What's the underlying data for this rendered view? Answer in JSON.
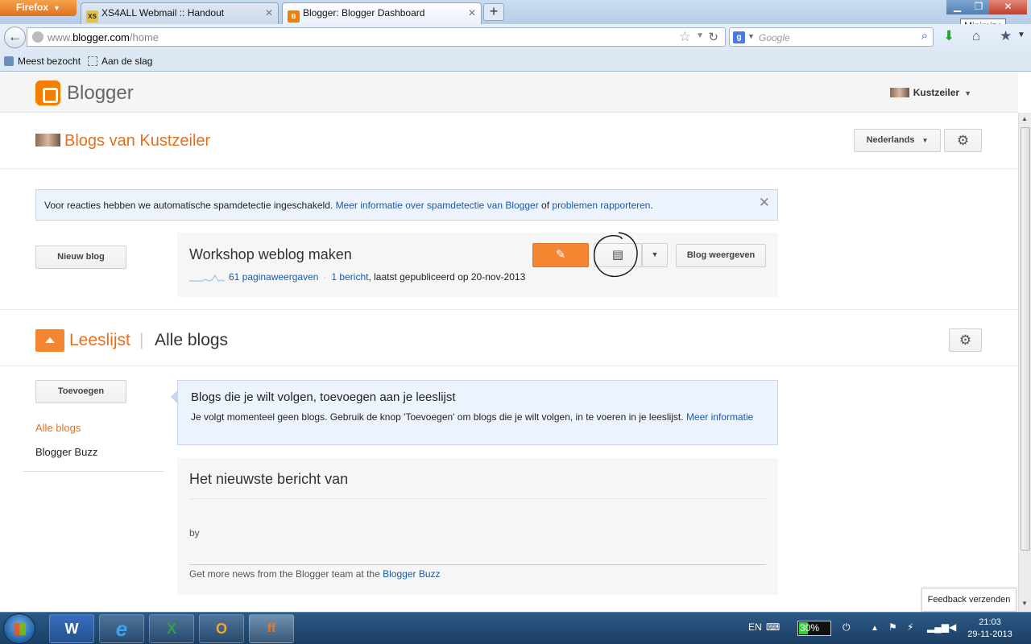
{
  "browser": {
    "app_button": "Firefox",
    "tabs": [
      {
        "label": "XS4ALL Webmail :: Handout",
        "favicon": "XS"
      },
      {
        "label": "Blogger: Blogger Dashboard",
        "favicon": "B"
      }
    ],
    "url_scheme": "www.",
    "url_host": "blogger.com",
    "url_path": "/home",
    "search_placeholder": "Google",
    "tooltip": "Minimize",
    "bookmarks": [
      "Meest bezocht",
      "Aan de slag"
    ]
  },
  "header": {
    "logo_text": "Blogger",
    "user_name": "Kustzeiler"
  },
  "blogs_section": {
    "title": "Blogs van Kustzeiler",
    "language_button": "Nederlands",
    "notice": {
      "text": "Voor reacties hebben we automatische spamdetectie ingeschakeld.",
      "link1": "Meer informatie over spamdetectie van Blogger",
      "middle": "of",
      "link2": "problemen rapporteren",
      "end": "."
    },
    "new_blog_button": "Nieuw blog",
    "blog": {
      "name": "Workshop weblog maken",
      "pageviews": "61 paginaweergaven",
      "sep": "·",
      "posts": "1 bericht",
      "last_published": ", laatst gepubliceerd op 20-nov-2013",
      "view_button": "Blog weergeven"
    }
  },
  "reading_list": {
    "title": "Leeslijst",
    "divider": "|",
    "subtitle": "Alle blogs",
    "add_button": "Toevoegen",
    "sidebar": [
      "Alle blogs",
      "Blogger Buzz"
    ],
    "info_title": "Blogs die je wilt volgen, toevoegen aan je leeslijst",
    "info_text": "Je volgt momenteel geen blogs. Gebruik de knop 'Toevoegen' om blogs die je wilt volgen, in te voeren in je leeslijst.",
    "info_link": "Meer informatie",
    "post_title": "Het nieuwste bericht van",
    "post_by": "by",
    "post_footer": "Get more news from the Blogger team at the",
    "post_footer_link": "Blogger Buzz"
  },
  "feedback_button": "Feedback verzenden",
  "taskbar": {
    "apps": [
      "W",
      "e",
      "X",
      "O",
      "ff"
    ],
    "lang": "EN",
    "battery": "30%",
    "time": "21:03",
    "date": "29-11-2013"
  },
  "colors": {
    "blogger_orange": "#f57d00",
    "link_blue": "#1a5aa8",
    "edit_orange": "#f48631"
  }
}
